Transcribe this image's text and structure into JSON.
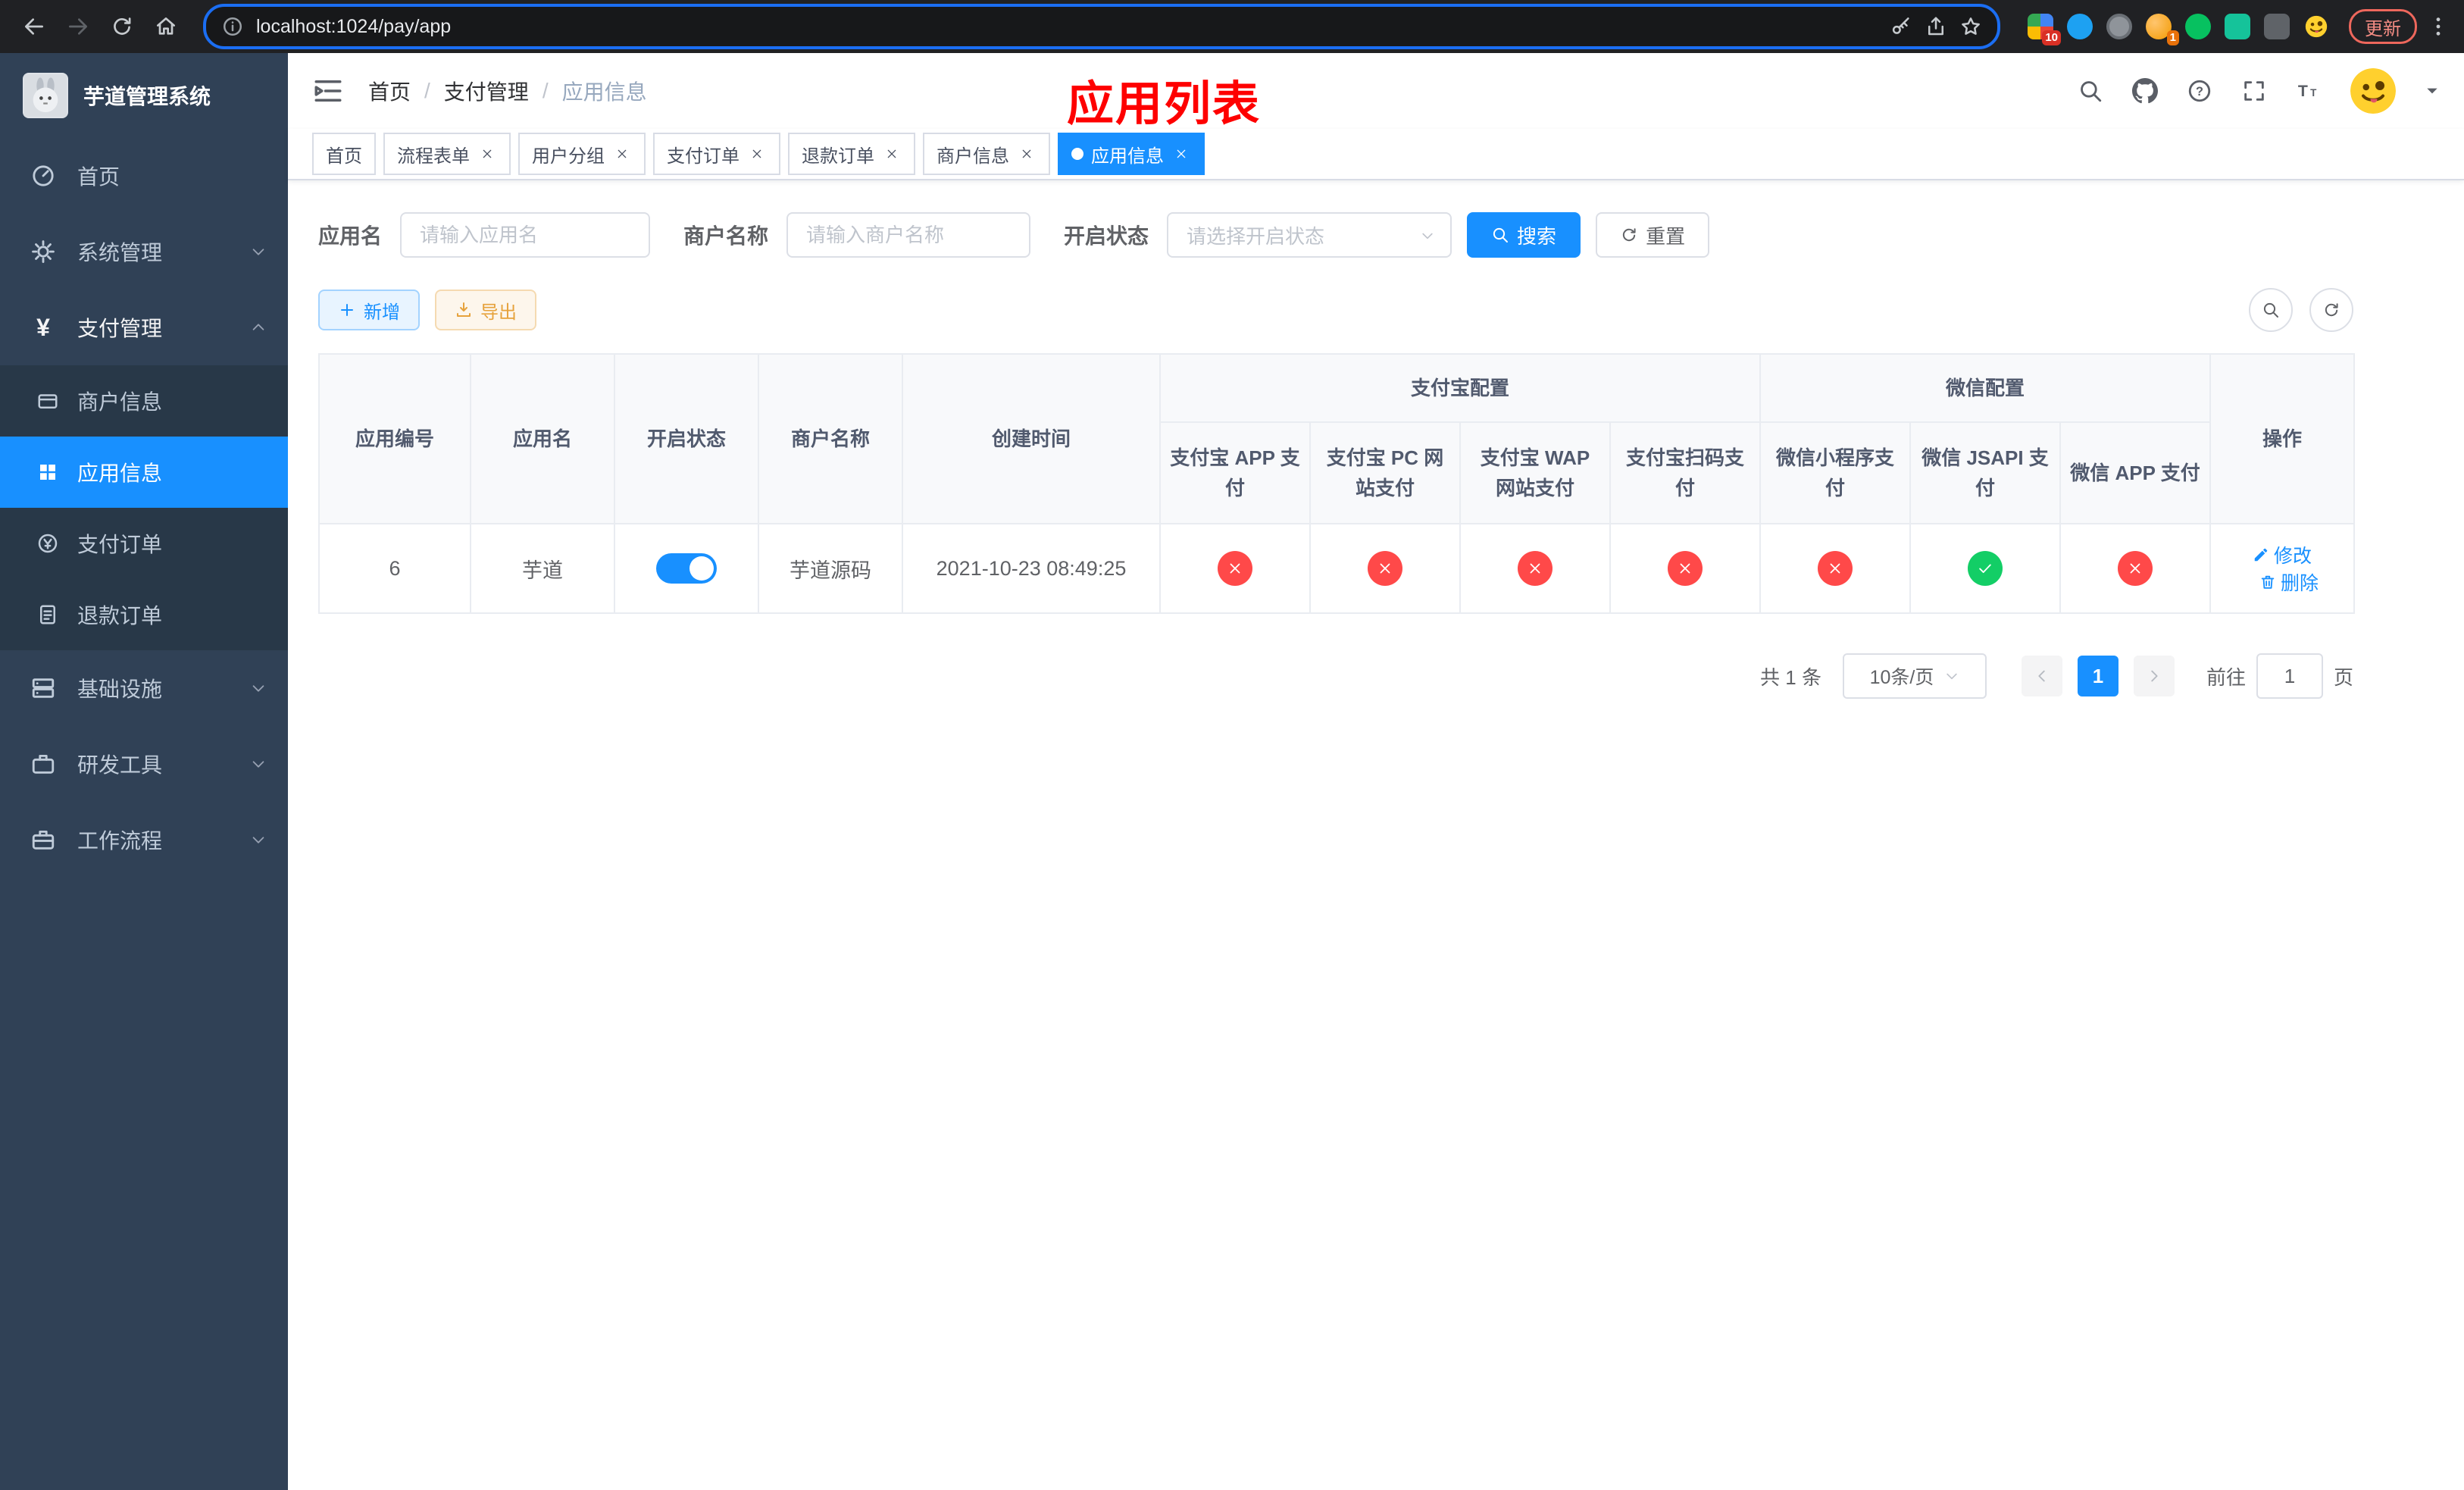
{
  "browser": {
    "url": "localhost:1024/pay/app",
    "update_label": "更新",
    "extension_badge_count": "10",
    "avatar_badge_count": "1"
  },
  "sidebar": {
    "title": "芋道管理系统",
    "items": [
      {
        "label": "首页"
      },
      {
        "label": "系统管理"
      },
      {
        "label": "支付管理",
        "children": [
          {
            "label": "商户信息"
          },
          {
            "label": "应用信息",
            "active": true
          },
          {
            "label": "支付订单"
          },
          {
            "label": "退款订单"
          }
        ]
      },
      {
        "label": "基础设施"
      },
      {
        "label": "研发工具"
      },
      {
        "label": "工作流程"
      }
    ]
  },
  "header": {
    "breadcrumb": [
      "首页",
      "支付管理",
      "应用信息"
    ],
    "separator": "/",
    "annotation": "应用列表"
  },
  "tabs": [
    {
      "label": "首页",
      "closable": false
    },
    {
      "label": "流程表单",
      "closable": true
    },
    {
      "label": "用户分组",
      "closable": true
    },
    {
      "label": "支付订单",
      "closable": true
    },
    {
      "label": "退款订单",
      "closable": true
    },
    {
      "label": "商户信息",
      "closable": true
    },
    {
      "label": "应用信息",
      "closable": true,
      "active": true
    }
  ],
  "filters": {
    "app_name_label": "应用名",
    "app_name_placeholder": "请输入应用名",
    "merchant_label": "商户名称",
    "merchant_placeholder": "请输入商户名称",
    "status_label": "开启状态",
    "status_placeholder": "请选择开启状态",
    "search_label": "搜索",
    "reset_label": "重置"
  },
  "toolbar": {
    "add_label": "新增",
    "export_label": "导出"
  },
  "table": {
    "headers": {
      "app_id": "应用编号",
      "app_name": "应用名",
      "status": "开启状态",
      "merchant": "商户名称",
      "created": "创建时间",
      "alipay_group": "支付宝配置",
      "wechat_group": "微信配置",
      "alipay_app": "支付宝 APP 支付",
      "alipay_pc": "支付宝 PC 网站支付",
      "alipay_wap": "支付宝 WAP 网站支付",
      "alipay_qr": "支付宝扫码支付",
      "wx_mini": "微信小程序支付",
      "wx_jsapi": "微信 JSAPI 支付",
      "wx_app": "微信 APP 支付",
      "actions": "操作"
    },
    "row": {
      "app_id": "6",
      "app_name": "芋道",
      "status": "on",
      "merchant": "芋道源码",
      "created": "2021-10-23 08:49:25",
      "alipay_app": "disabled",
      "alipay_pc": "disabled",
      "alipay_wap": "disabled",
      "alipay_qr": "disabled",
      "wx_mini": "disabled",
      "wx_jsapi": "enabled",
      "wx_app": "disabled",
      "edit_label": "修改",
      "delete_label": "删除"
    }
  },
  "pagination": {
    "total": "共 1 条",
    "page_size": "10条/页",
    "current_page": "1",
    "goto_label": "前往",
    "goto_value": "1",
    "page_unit": "页"
  },
  "colors": {
    "primary": "#1890ff",
    "danger": "#ff4949",
    "success": "#13ce66",
    "annotation": "#fe0000"
  }
}
